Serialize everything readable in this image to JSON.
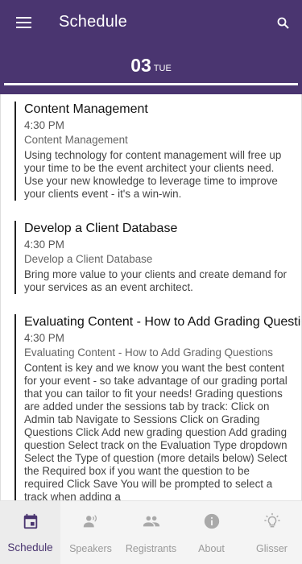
{
  "header": {
    "title": "Schedule",
    "date_day": "03",
    "date_dow": "TUE"
  },
  "sessions": [
    {
      "title": "Content Management",
      "time": "4:30 PM",
      "subtitle": "Content Management",
      "description": "Using technology for content management will free up your time to be the event architect your clients need. Use your new knowledge to leverage time to improve your clients event - it's a win-win."
    },
    {
      "title": "Develop a Client Database",
      "time": "4:30 PM",
      "subtitle": "Develop a Client Database",
      "description": "Bring more value to your clients and create demand for your services as an event architect."
    },
    {
      "title": "Evaluating Content - How to Add Grading Questions",
      "time": "4:30 PM",
      "subtitle": "Evaluating Content - How to Add Grading Questions",
      "description": "Content is key and we know you want the best content for your event - so take advantage of our grading portal that you can tailor to fit your needs! Grading questions are added under the sessions tab by track: Click on Admin tab Navigate to Sessions Click on Grading Questions Click Add new grading question Add grading question Select track on the Evaluation Type dropdown Select the Type of question (more details below) Select the Required box if you want the question to be required Click Save You will be prompted to select a track when adding a"
    }
  ],
  "bottom_nav": [
    {
      "label": "Schedule",
      "icon": "calendar-icon",
      "active": true
    },
    {
      "label": "Speakers",
      "icon": "speakers-icon",
      "active": false
    },
    {
      "label": "Registrants",
      "icon": "people-icon",
      "active": false
    },
    {
      "label": "About",
      "icon": "info-icon",
      "active": false
    },
    {
      "label": "Glisser",
      "icon": "lightbulb-icon",
      "active": false
    }
  ],
  "colors": {
    "primary": "#4a3570",
    "inactive": "#9a9a9a"
  }
}
